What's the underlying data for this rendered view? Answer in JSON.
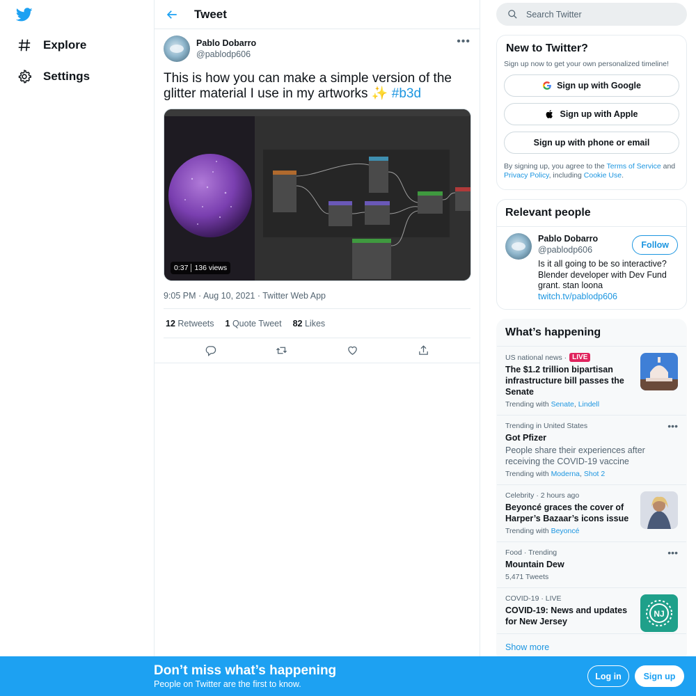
{
  "nav": {
    "logo": "twitter-bird-logo",
    "items": [
      {
        "label": "Explore",
        "icon": "hashtag-icon"
      },
      {
        "label": "Settings",
        "icon": "gear-icon"
      }
    ]
  },
  "header": {
    "title": "Tweet"
  },
  "tweet": {
    "author_name": "Pablo Dobarro",
    "author_handle": "@pablodp606",
    "text": "This is how you can make a simple version of the glitter material I use in my artworks ✨ ",
    "hashtag": "#b3d",
    "video_duration": "0:37",
    "video_views": "136 views",
    "timestamp": "9:05 PM · Aug 10, 2021 · Twitter Web App",
    "retweets_count": "12",
    "retweets_label": "Retweets",
    "quotes_count": "1",
    "quotes_label": "Quote Tweet",
    "likes_count": "82",
    "likes_label": "Likes"
  },
  "search": {
    "placeholder": "Search Twitter"
  },
  "signup": {
    "title": "New to Twitter?",
    "subtitle": "Sign up now to get your own personalized timeline!",
    "google": "Sign up with Google",
    "apple": "Sign up with Apple",
    "phone": "Sign up with phone or email",
    "legal_pre": "By signing up, you agree to the ",
    "tos": "Terms of Service",
    "legal_mid": " and ",
    "privacy": "Privacy Policy",
    "legal_mid2": ", including ",
    "cookie": "Cookie Use",
    "legal_end": "."
  },
  "people": {
    "title": "Relevant people",
    "name": "Pablo Dobarro",
    "handle": "@pablodp606",
    "follow": "Follow",
    "bio": "Is it all going to be so interactive? Blender developer with Dev Fund grant. stan loona ",
    "bio_link": "twitch.tv/pablodp606"
  },
  "happening": {
    "title": "What’s happening",
    "trends": [
      {
        "meta": "US national news · ",
        "live": "LIVE",
        "title": "The $1.2 trillion bipartisan infrastructure bill passes the Senate",
        "with_label": "Trending with ",
        "with1": "Senate",
        "with2": "Lindell"
      },
      {
        "meta": "Trending in United States",
        "title": "Got Pfizer",
        "desc": "People share their experiences after receiving the COVID-19 vaccine",
        "with_label": "Trending with ",
        "with1": "Moderna",
        "with2": "Shot 2"
      },
      {
        "meta": "Celebrity · 2 hours ago",
        "title": "Beyoncé graces the cover of Harper’s Bazaar’s icons issue",
        "with_label": "Trending with ",
        "with1": "Beyoncé"
      },
      {
        "meta": "Food · Trending",
        "title": "Mountain Dew",
        "count": "5,471 Tweets"
      },
      {
        "meta": "COVID-19 · LIVE",
        "title": "COVID-19: News and updates for New Jersey",
        "thumb_text": "NJ"
      }
    ],
    "show_more": "Show more"
  },
  "bottom": {
    "title": "Don’t miss what’s happening",
    "subtitle": "People on Twitter are the first to know.",
    "login": "Log in",
    "signup": "Sign up"
  },
  "colors": {
    "accent": "#1da1f2",
    "link": "#1b95e0",
    "live": "#e0245e"
  }
}
